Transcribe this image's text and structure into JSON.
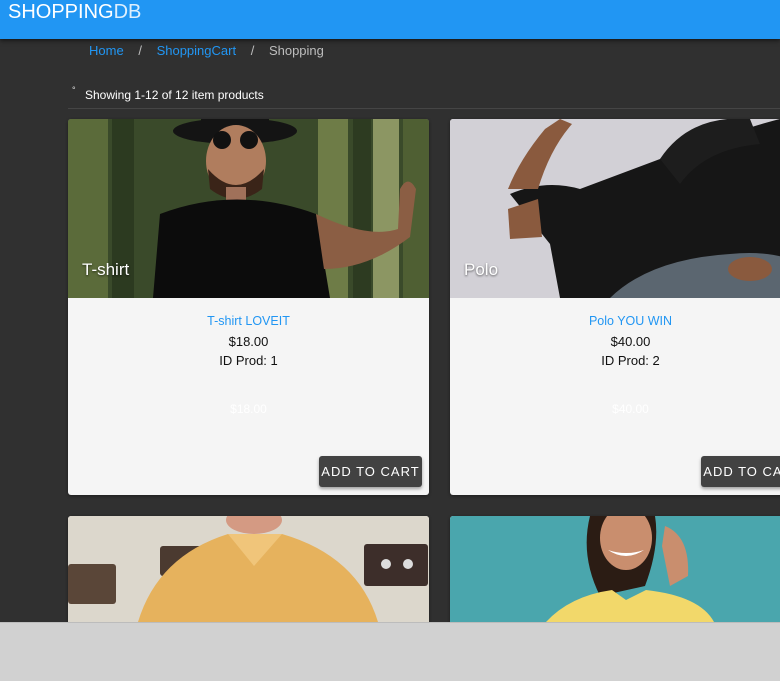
{
  "header": {
    "brand_bold": "SHOPPING",
    "brand_light": "DB"
  },
  "breadcrumb": [
    {
      "label": "Home"
    },
    {
      "label": "ShoppingCart"
    },
    {
      "label": "Shopping"
    }
  ],
  "results": {
    "text": "Showing 1-12 of 12 item products"
  },
  "products": [
    {
      "media_title": "T-shirt",
      "name": "T-shirt LOVEIT",
      "price": "$18.00",
      "id_label": "ID Prod: 1",
      "ghost_price": "$18.00",
      "button": "ADD TO CART"
    },
    {
      "media_title": "Polo",
      "name": "Polo YOU WIN",
      "price": "$40.00",
      "id_label": "ID Prod: 2",
      "ghost_price": "$40.00",
      "button": "ADD TO CART"
    }
  ],
  "colors": {
    "primary": "#2196f3",
    "background": "#303030",
    "card": "#f5f5f5",
    "button": "#424242"
  }
}
